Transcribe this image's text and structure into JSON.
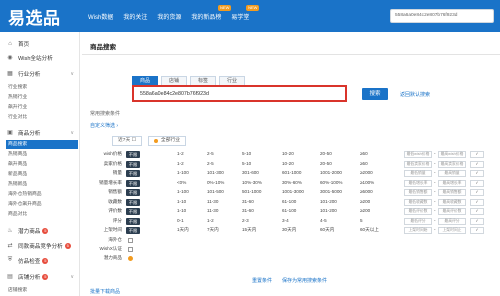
{
  "header": {
    "logo": "易选品",
    "nav": [
      {
        "label": "Wish数据",
        "badge": ""
      },
      {
        "label": "我的关注",
        "badge": ""
      },
      {
        "label": "我的货源",
        "badge": ""
      },
      {
        "label": "我的新品榜",
        "badge": "NEW"
      },
      {
        "label": "易学堂",
        "badge": "NEW"
      }
    ],
    "search_value": "558a6a0e84c2e807b76f923d",
    "colors": {
      "primary": "#1a73c8",
      "badge": "#f29b1f"
    }
  },
  "sidebar": {
    "items": [
      {
        "label": "首页",
        "icon": "home-icon"
      },
      {
        "label": "Wish全站分析",
        "icon": "globe-icon"
      },
      {
        "label": "行业分析",
        "icon": "grid-icon"
      },
      {
        "label": "商品分析",
        "icon": "box-icon"
      },
      {
        "label": "潜力商品",
        "icon": "fire-icon"
      },
      {
        "label": "同款商品竞争分析",
        "icon": "compare-icon"
      },
      {
        "label": "仿品检查",
        "icon": "shield-icon"
      },
      {
        "label": "店铺分析",
        "icon": "store-icon"
      }
    ],
    "industry_sub": [
      "行业搜索",
      "热销行业",
      "飙升行业",
      "行业对比"
    ],
    "product_sub": [
      "商品搜索",
      "热销商品",
      "飙升商品",
      "新品商品",
      "热销新品",
      "海外仓热销商品",
      "海外仓飙升商品",
      "商品对比"
    ],
    "store_sub": [
      "店铺搜索"
    ],
    "badges": [
      "5",
      "5",
      "5",
      "5"
    ]
  },
  "main": {
    "title": "商品搜索",
    "tabs": [
      "商品",
      "店铺",
      "标签",
      "行业"
    ],
    "search_input": "558a6a0e84c2e807b76f923d",
    "search_button": "搜索",
    "reset_link": "返回默认搜索",
    "common_conditions": "常用搜索条件",
    "custom_filter": "自定义筛选",
    "cat_buttons": [
      "近7天 ☐",
      "全部行业"
    ],
    "filters": [
      {
        "label": "wish价格",
        "badge": "不限",
        "cells": [
          "1-2",
          "2-5",
          "5-10",
          "10-20",
          "20-50",
          "≥50"
        ],
        "min": "最低wish价格",
        "max": "最高wish价格"
      },
      {
        "label": "卖家价格",
        "badge": "不限",
        "cells": [
          "1-2",
          "2-5",
          "5-10",
          "10-20",
          "20-50",
          "≥50"
        ],
        "min": "最低卖家价格",
        "max": "最高卖家价格"
      },
      {
        "label": "销量",
        "badge": "不限",
        "cells": [
          "1-100",
          "101-300",
          "301-600",
          "601-1000",
          "1001-2000",
          "≥2000"
        ],
        "min": "最低销量",
        "max": "最高销量"
      },
      {
        "label": "销量增长率",
        "badge": "不限",
        "cells": [
          "<0%",
          "0%-10%",
          "10%-30%",
          "30%-60%",
          "60%-100%",
          "≥100%"
        ],
        "min": "最低增长率",
        "max": "最高增长率"
      },
      {
        "label": "销售额",
        "badge": "不限",
        "cells": [
          "1-100",
          "101-500",
          "501-1000",
          "1001-3000",
          "3001-5000",
          "≥5000"
        ],
        "min": "最低销售额",
        "max": "最高销售额"
      },
      {
        "label": "收藏数",
        "badge": "不限",
        "cells": [
          "1-10",
          "11-30",
          "31-60",
          "61-100",
          "101-200",
          "≥200"
        ],
        "min": "最低收藏数",
        "max": "最高收藏数"
      },
      {
        "label": "评价数",
        "badge": "不限",
        "cells": [
          "1-10",
          "11-30",
          "31-60",
          "61-100",
          "101-200",
          "≥200"
        ],
        "min": "最低评价数",
        "max": "最高评价数"
      },
      {
        "label": "评分",
        "badge": "不限",
        "cells": [
          "0-1",
          "1-2",
          "2-3",
          "3-4",
          "4-5",
          "5"
        ],
        "min": "最低评分",
        "max": "最高评分"
      },
      {
        "label": "上架时间",
        "badge": "不限",
        "cells": [
          "1天内",
          "7天内",
          "15天内",
          "30天内",
          "60天内",
          "60天以上"
        ],
        "min": "上架时间始",
        "max": "上架时间止"
      }
    ],
    "checks": [
      {
        "label": "海外仓"
      },
      {
        "label": "WishX认证"
      },
      {
        "label": "潜力商品"
      }
    ],
    "bottom_links": [
      "重置条件",
      "保存为常用搜索条件"
    ],
    "batch_link": "批量下载商品"
  }
}
